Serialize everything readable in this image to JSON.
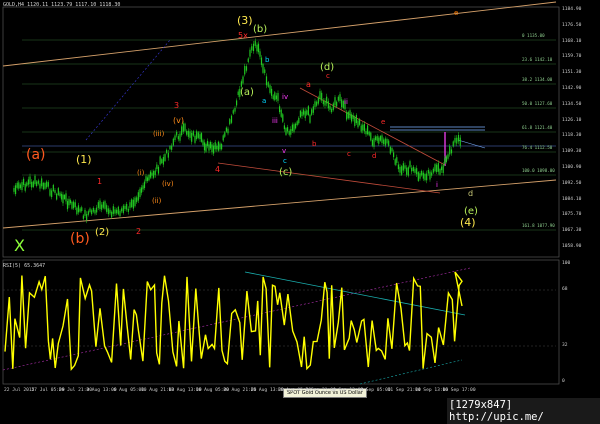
{
  "window": {
    "symbol_line": "GOLD,H4  1120.11 1123.79 1117.10 1118.30",
    "rsi_line": "RSI(5) 65.3647",
    "tooltip": "SPOT Gold Ounce vs US Dollar",
    "watermark": "[1279x847] http://upic.me/"
  },
  "colors": {
    "background": "#000000",
    "candle_up": "#22cc22",
    "rsi_line": "#ffff00",
    "channel_line": "#d4a06a",
    "orange_fib": "#ff7b00",
    "grid_dot": "#3a3a3a"
  },
  "price_axis": [
    "1184.90",
    "1176.50",
    "1168.10",
    "1159.70",
    "1151.30",
    "1142.90",
    "1134.50",
    "1126.10",
    "1118.30",
    "1109.30",
    "1100.90",
    "1092.50",
    "1084.10",
    "1075.70",
    "1067.30",
    "1058.90"
  ],
  "rsi_axis": [
    "100",
    "68",
    "32",
    "0"
  ],
  "time_axis": [
    "22 Jul 2015",
    "27 Jul 05:00",
    "29 Jul 21:00",
    "3 Aug 13:00",
    "6 Aug 05:00",
    "10 Aug 21:00",
    "13 Aug 13:00",
    "18 Aug 05:00",
    "20 Aug 21:00",
    "25 Aug 13:00",
    "28 Aug 05:00",
    "2 Sep 21:00",
    "4 Sep 13:00",
    "9 Sep 05:00",
    "11 Sep 21:00",
    "14 Sep 13:00",
    "16 Sep 17:00"
  ],
  "fib_labels": [
    "0 1135.00",
    "23.6 1142.10",
    "38.2 1134.00",
    "50.0 1127.60",
    "61.8 1121.40",
    "76.4 1112.50",
    "100.0 1098.00",
    "161.8 1077.90"
  ],
  "wave_labels": [
    {
      "text": "(a)",
      "color": "#ff5a1f"
    },
    {
      "text": "(1)",
      "color": "#ffe94d"
    },
    {
      "text": "1",
      "color": "#ff2a2a"
    },
    {
      "text": "(b)",
      "color": "#ff5a1f"
    },
    {
      "text": "(2)",
      "color": "#ffe94d"
    },
    {
      "text": "2",
      "color": "#ff2a2a"
    },
    {
      "text": "X",
      "color": "#8dff3a"
    },
    {
      "text": "(i)",
      "color": "#ff8c1a"
    },
    {
      "text": "(ii)",
      "color": "#ff8c1a"
    },
    {
      "text": "(iii)",
      "color": "#ff8c1a"
    },
    {
      "text": "(iv)",
      "color": "#ff8c1a"
    },
    {
      "text": "(v)",
      "color": "#ff8c1a"
    },
    {
      "text": "3",
      "color": "#ff2a2a"
    },
    {
      "text": "4",
      "color": "#ff2a2a"
    },
    {
      "text": "(3)",
      "color": "#ffe94d"
    },
    {
      "text": "5x",
      "color": "#ff2a2a"
    },
    {
      "text": "(b)",
      "color": "#b7f05a"
    },
    {
      "text": "(a)",
      "color": "#b7f05a"
    },
    {
      "text": "(c)",
      "color": "#b7f05a"
    },
    {
      "text": "(d)",
      "color": "#b7f05a"
    },
    {
      "text": "(e)",
      "color": "#b7f05a"
    },
    {
      "text": "(4)",
      "color": "#ffe94d"
    },
    {
      "text": "a",
      "color": "#ff2a2a"
    },
    {
      "text": "b",
      "color": "#ff2a2a"
    },
    {
      "text": "c",
      "color": "#ff2a2a"
    },
    {
      "text": "d",
      "color": "#ff2a2a"
    },
    {
      "text": "e",
      "color": "#ff2a2a"
    },
    {
      "text": "c",
      "color": "#ff2a2a"
    },
    {
      "text": "b",
      "color": "#00d7ff"
    },
    {
      "text": "a",
      "color": "#00d7ff"
    },
    {
      "text": "c",
      "color": "#00d7ff"
    },
    {
      "text": "v",
      "color": "#ff3bff"
    },
    {
      "text": "iv",
      "color": "#ff3bff"
    },
    {
      "text": "iii",
      "color": "#ff3bff"
    },
    {
      "text": "ii",
      "color": "#ff3bff"
    },
    {
      "text": "i",
      "color": "#ff3bff"
    },
    {
      "text": "d",
      "color": "#c9c978"
    },
    {
      "text": "e",
      "color": "#ff7b00"
    }
  ]
}
